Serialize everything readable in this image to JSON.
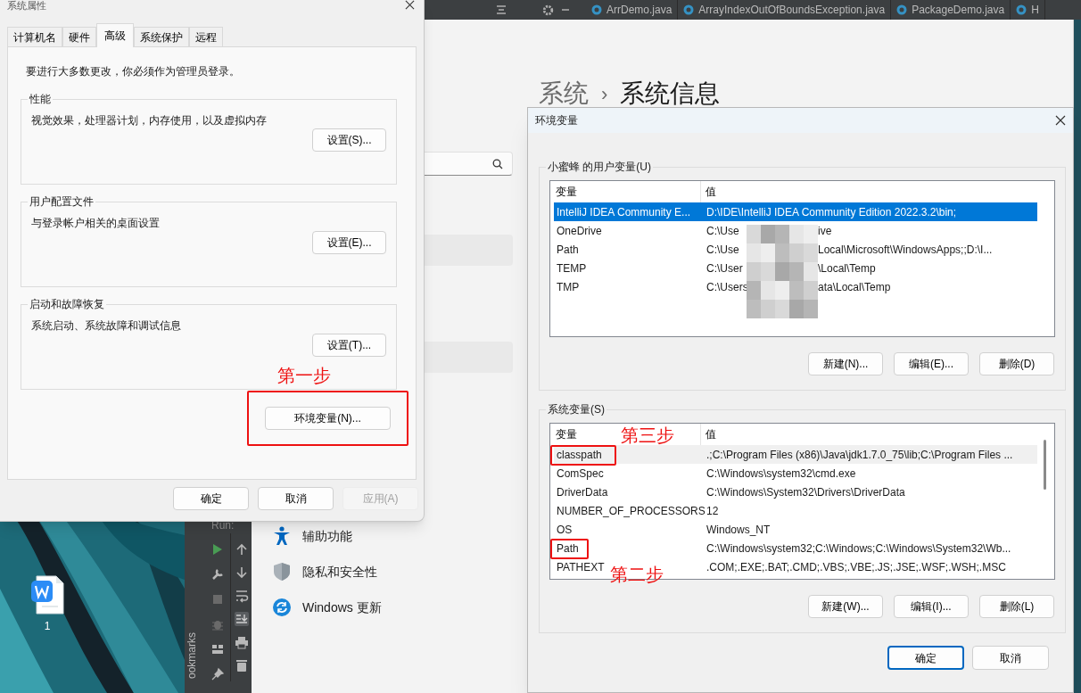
{
  "ide": {
    "tabs": [
      {
        "label": "ArrDemo.java"
      },
      {
        "label": "ArrayIndexOutOfBoundsException.java"
      },
      {
        "label": "PackageDemo.java"
      },
      {
        "label": "H"
      }
    ],
    "run_label": "Run:",
    "bookmarks_label": "ookmarks"
  },
  "desktop": {
    "icons": [
      {
        "label": "1"
      }
    ]
  },
  "settings": {
    "breadcrumb": [
      "系统",
      "系统信息"
    ],
    "separator": "›",
    "nav_items": [
      {
        "kind": "accessibility",
        "label": "辅助功能"
      },
      {
        "kind": "privacy",
        "label": "隐私和安全性"
      },
      {
        "kind": "update",
        "label": "Windows 更新"
      }
    ]
  },
  "system_properties": {
    "title": "系统属性",
    "tabs": [
      {
        "label": "计算机名",
        "selected": false
      },
      {
        "label": "硬件",
        "selected": false
      },
      {
        "label": "高级",
        "selected": true
      },
      {
        "label": "系统保护",
        "selected": false
      },
      {
        "label": "远程",
        "selected": false
      }
    ],
    "notice": "要进行大多数更改，你必须作为管理员登录。",
    "groups": [
      {
        "title": "性能",
        "description": "视觉效果，处理器计划，内存使用，以及虚拟内存",
        "button": "设置(S)..."
      },
      {
        "title": "用户配置文件",
        "description": "与登录帐户相关的桌面设置",
        "button": "设置(E)..."
      },
      {
        "title": "启动和故障恢复",
        "description": "系统启动、系统故障和调试信息",
        "button": "设置(T)..."
      }
    ],
    "env_button": {
      "label": "环境变量(N)...",
      "highlighted": true
    },
    "buttons": [
      {
        "label": "确定",
        "disabled": false
      },
      {
        "label": "取消",
        "disabled": false
      },
      {
        "label": "应用(A)",
        "disabled": true
      }
    ]
  },
  "env_vars": {
    "title": "环境变量",
    "user_group": {
      "title": "小蜜蜂 的用户变量(U)",
      "columns": [
        "变量",
        "值"
      ],
      "rows": [
        {
          "name": "IntelliJ IDEA Community E...",
          "value": "D:\\IDE\\IntelliJ IDEA Community Edition 2022.3.2\\bin;",
          "selected": true
        },
        {
          "name": "OneDrive",
          "value": "C:\\Use",
          "value_end": "ive",
          "selected": false
        },
        {
          "name": "Path",
          "value": "C:\\Use",
          "value_end": "Local\\Microsoft\\WindowsApps;;D:\\I...",
          "selected": false
        },
        {
          "name": "TEMP",
          "value": "C:\\User",
          "value_end": "\\Local\\Temp",
          "selected": false
        },
        {
          "name": "TMP",
          "value": "C:\\Users",
          "value_end": "ata\\Local\\Temp",
          "selected": false
        }
      ],
      "buttons": [
        "新建(N)...",
        "编辑(E)...",
        "删除(D)"
      ]
    },
    "system_group": {
      "title": "系统变量(S)",
      "columns": [
        "变量",
        "值"
      ],
      "rows": [
        {
          "name": "classpath",
          "value": ".;C:\\Program Files (x86)\\Java\\jdk1.7.0_75\\lib;C:\\Program Files ...",
          "selected": false,
          "hovered": true,
          "highlighted": true
        },
        {
          "name": "ComSpec",
          "value": "C:\\Windows\\system32\\cmd.exe",
          "selected": false,
          "hovered": false,
          "highlighted": false
        },
        {
          "name": "DriverData",
          "value": "C:\\Windows\\System32\\Drivers\\DriverData",
          "selected": false,
          "hovered": false,
          "highlighted": false
        },
        {
          "name": "NUMBER_OF_PROCESSORS",
          "value": "12",
          "selected": false,
          "hovered": false,
          "highlighted": false
        },
        {
          "name": "OS",
          "value": "Windows_NT",
          "selected": false,
          "hovered": false,
          "highlighted": false
        },
        {
          "name": "Path",
          "value": "C:\\Windows\\system32;C:\\Windows;C:\\Windows\\System32\\Wb...",
          "selected": false,
          "hovered": false,
          "highlighted": true
        },
        {
          "name": "PATHEXT",
          "value": ".COM;.EXE;.BAT;.CMD;.VBS;.VBE;.JS;.JSE;.WSF;.WSH;.MSC",
          "selected": false,
          "hovered": false,
          "highlighted": false
        }
      ],
      "buttons": [
        "新建(W)...",
        "编辑(I)...",
        "删除(L)"
      ]
    },
    "buttons": [
      {
        "label": "确定",
        "focused": true
      },
      {
        "label": "取消",
        "focused": false
      }
    ]
  },
  "annotations": [
    "第一步",
    "第二步",
    "第三步"
  ]
}
